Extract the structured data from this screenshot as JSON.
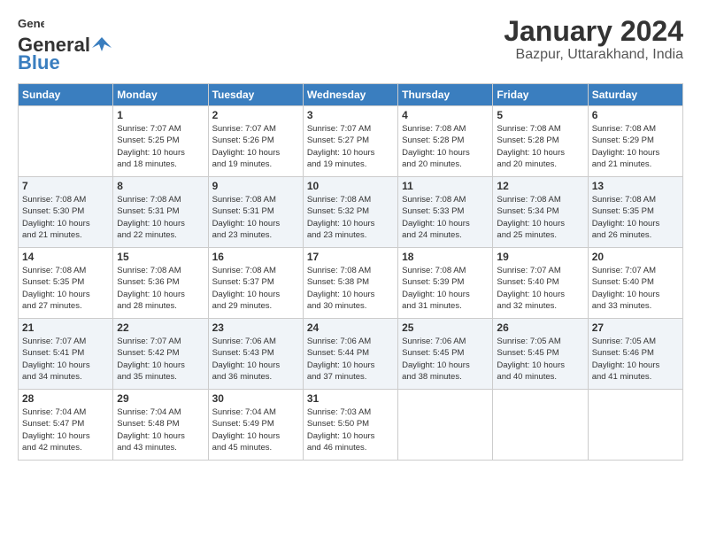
{
  "header": {
    "logo_line1": "General",
    "logo_line2": "Blue",
    "month_year": "January 2024",
    "location": "Bazpur, Uttarakhand, India"
  },
  "days_of_week": [
    "Sunday",
    "Monday",
    "Tuesday",
    "Wednesday",
    "Thursday",
    "Friday",
    "Saturday"
  ],
  "weeks": [
    [
      {
        "day": "",
        "info": ""
      },
      {
        "day": "1",
        "info": "Sunrise: 7:07 AM\nSunset: 5:25 PM\nDaylight: 10 hours\nand 18 minutes."
      },
      {
        "day": "2",
        "info": "Sunrise: 7:07 AM\nSunset: 5:26 PM\nDaylight: 10 hours\nand 19 minutes."
      },
      {
        "day": "3",
        "info": "Sunrise: 7:07 AM\nSunset: 5:27 PM\nDaylight: 10 hours\nand 19 minutes."
      },
      {
        "day": "4",
        "info": "Sunrise: 7:08 AM\nSunset: 5:28 PM\nDaylight: 10 hours\nand 20 minutes."
      },
      {
        "day": "5",
        "info": "Sunrise: 7:08 AM\nSunset: 5:28 PM\nDaylight: 10 hours\nand 20 minutes."
      },
      {
        "day": "6",
        "info": "Sunrise: 7:08 AM\nSunset: 5:29 PM\nDaylight: 10 hours\nand 21 minutes."
      }
    ],
    [
      {
        "day": "7",
        "info": "Sunrise: 7:08 AM\nSunset: 5:30 PM\nDaylight: 10 hours\nand 21 minutes."
      },
      {
        "day": "8",
        "info": "Sunrise: 7:08 AM\nSunset: 5:31 PM\nDaylight: 10 hours\nand 22 minutes."
      },
      {
        "day": "9",
        "info": "Sunrise: 7:08 AM\nSunset: 5:31 PM\nDaylight: 10 hours\nand 23 minutes."
      },
      {
        "day": "10",
        "info": "Sunrise: 7:08 AM\nSunset: 5:32 PM\nDaylight: 10 hours\nand 23 minutes."
      },
      {
        "day": "11",
        "info": "Sunrise: 7:08 AM\nSunset: 5:33 PM\nDaylight: 10 hours\nand 24 minutes."
      },
      {
        "day": "12",
        "info": "Sunrise: 7:08 AM\nSunset: 5:34 PM\nDaylight: 10 hours\nand 25 minutes."
      },
      {
        "day": "13",
        "info": "Sunrise: 7:08 AM\nSunset: 5:35 PM\nDaylight: 10 hours\nand 26 minutes."
      }
    ],
    [
      {
        "day": "14",
        "info": "Sunrise: 7:08 AM\nSunset: 5:35 PM\nDaylight: 10 hours\nand 27 minutes."
      },
      {
        "day": "15",
        "info": "Sunrise: 7:08 AM\nSunset: 5:36 PM\nDaylight: 10 hours\nand 28 minutes."
      },
      {
        "day": "16",
        "info": "Sunrise: 7:08 AM\nSunset: 5:37 PM\nDaylight: 10 hours\nand 29 minutes."
      },
      {
        "day": "17",
        "info": "Sunrise: 7:08 AM\nSunset: 5:38 PM\nDaylight: 10 hours\nand 30 minutes."
      },
      {
        "day": "18",
        "info": "Sunrise: 7:08 AM\nSunset: 5:39 PM\nDaylight: 10 hours\nand 31 minutes."
      },
      {
        "day": "19",
        "info": "Sunrise: 7:07 AM\nSunset: 5:40 PM\nDaylight: 10 hours\nand 32 minutes."
      },
      {
        "day": "20",
        "info": "Sunrise: 7:07 AM\nSunset: 5:40 PM\nDaylight: 10 hours\nand 33 minutes."
      }
    ],
    [
      {
        "day": "21",
        "info": "Sunrise: 7:07 AM\nSunset: 5:41 PM\nDaylight: 10 hours\nand 34 minutes."
      },
      {
        "day": "22",
        "info": "Sunrise: 7:07 AM\nSunset: 5:42 PM\nDaylight: 10 hours\nand 35 minutes."
      },
      {
        "day": "23",
        "info": "Sunrise: 7:06 AM\nSunset: 5:43 PM\nDaylight: 10 hours\nand 36 minutes."
      },
      {
        "day": "24",
        "info": "Sunrise: 7:06 AM\nSunset: 5:44 PM\nDaylight: 10 hours\nand 37 minutes."
      },
      {
        "day": "25",
        "info": "Sunrise: 7:06 AM\nSunset: 5:45 PM\nDaylight: 10 hours\nand 38 minutes."
      },
      {
        "day": "26",
        "info": "Sunrise: 7:05 AM\nSunset: 5:45 PM\nDaylight: 10 hours\nand 40 minutes."
      },
      {
        "day": "27",
        "info": "Sunrise: 7:05 AM\nSunset: 5:46 PM\nDaylight: 10 hours\nand 41 minutes."
      }
    ],
    [
      {
        "day": "28",
        "info": "Sunrise: 7:04 AM\nSunset: 5:47 PM\nDaylight: 10 hours\nand 42 minutes."
      },
      {
        "day": "29",
        "info": "Sunrise: 7:04 AM\nSunset: 5:48 PM\nDaylight: 10 hours\nand 43 minutes."
      },
      {
        "day": "30",
        "info": "Sunrise: 7:04 AM\nSunset: 5:49 PM\nDaylight: 10 hours\nand 45 minutes."
      },
      {
        "day": "31",
        "info": "Sunrise: 7:03 AM\nSunset: 5:50 PM\nDaylight: 10 hours\nand 46 minutes."
      },
      {
        "day": "",
        "info": ""
      },
      {
        "day": "",
        "info": ""
      },
      {
        "day": "",
        "info": ""
      }
    ]
  ]
}
